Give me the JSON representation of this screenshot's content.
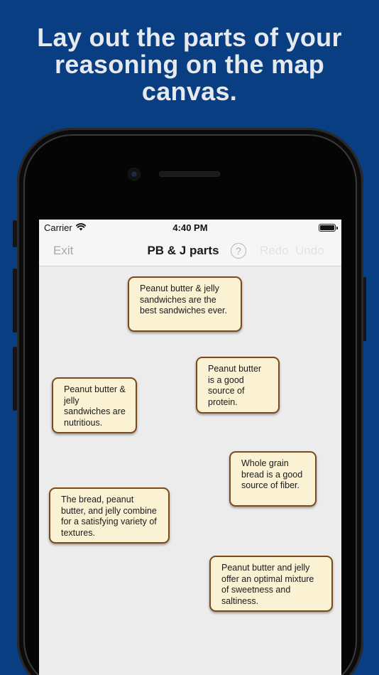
{
  "headline": {
    "line1": "Lay out the parts of your",
    "line2": "reasoning on the map",
    "line3": "canvas."
  },
  "status_bar": {
    "carrier": "Carrier",
    "time": "4:40 PM"
  },
  "nav": {
    "exit_label": "Exit",
    "title": "PB & J parts",
    "help_label": "?",
    "redo_label": "Redo",
    "undo_label": "Undo"
  },
  "notes": [
    "Peanut butter & jelly sandwiches are the best sandwiches ever.",
    "Peanut butter is a good source of protein.",
    "Peanut butter & jelly sandwiches are nutritious.",
    "Whole grain bread is a good source of fiber.",
    "The bread, peanut butter, and jelly combine for a satisfying variety of textures.",
    "Peanut butter and jelly offer an optimal mixture of sweetness and saltiness."
  ],
  "colors": {
    "background": "#0a3e82",
    "note_fill": "#fbf2d3",
    "note_border": "#7a4a1d"
  },
  "icons": [
    "wifi-icon",
    "battery-icon",
    "help-icon",
    "camera-icon",
    "speaker-icon"
  ]
}
